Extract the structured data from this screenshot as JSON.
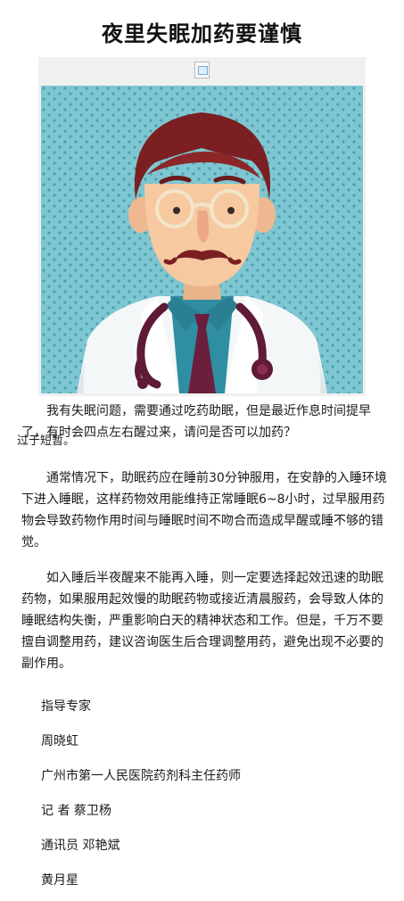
{
  "title": "夜里失眠加药要谨慎",
  "figure": {
    "broken_image_icon": "broken-image-icon",
    "illustration": "doctor-illustration",
    "colors": {
      "background": "#7ec7d2",
      "dots": "#4d9fae",
      "hair": "#7b1f22",
      "skin": "#f6c9a0",
      "coat": "#f4f7f8",
      "tie": "#6b1f3d",
      "shirt": "#2f8ea2",
      "stethoscope": "#5e1a37"
    }
  },
  "question": "我有失眠问题，需要通过吃药助眠，但是最近作息时间提早了，有时会四点左右醒过来，请问是否可以加药？",
  "question_overflow": "过于短暂。",
  "paragraphs": [
    "通常情况下，助眠药应在睡前30分钟服用，在安静的入睡环境下进入睡眠，这样药物效用能维持正常睡眠6~8小时，过早服用药物会导致药物作用时间与睡眠时间不吻合而造成早醒或睡不够的错觉。",
    "如入睡后半夜醒来不能再入睡，则一定要选择起效迅速的助眠药物，如果服用起效慢的助眠药物或接近清晨服药，会导致人体的睡眠结构失衡，严重影响白天的精神状态和工作。但是，千万不要擅自调整用药，建议咨询医生后合理调整用药，避免出现不必要的副作用。"
  ],
  "credits": [
    "指导专家",
    "周晓虹",
    "广州市第一人民医院药剂科主任药师",
    "记 者 蔡卫杨",
    "通讯员 邓艳斌",
    "黄月星"
  ]
}
